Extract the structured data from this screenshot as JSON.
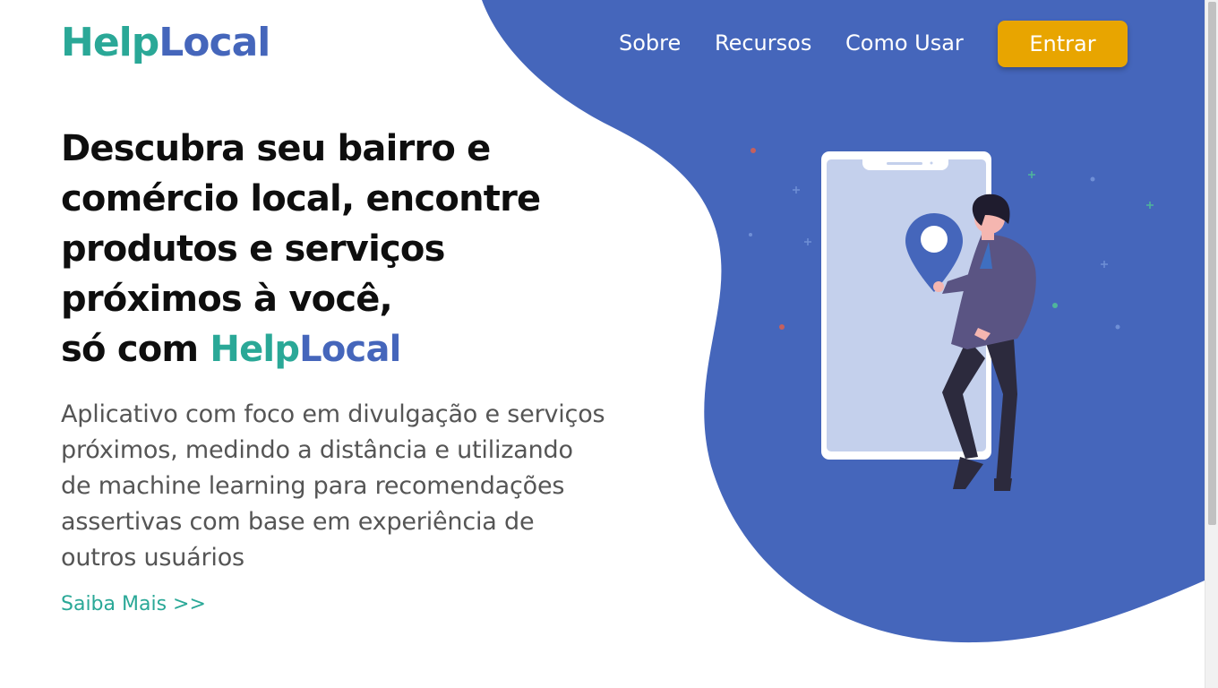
{
  "brand": {
    "help": "Help",
    "local": "Local"
  },
  "nav": {
    "items": [
      {
        "label": "Sobre"
      },
      {
        "label": "Recursos"
      },
      {
        "label": "Como Usar"
      }
    ],
    "cta_label": "Entrar"
  },
  "hero": {
    "headline_lines": [
      "Descubra seu bairro e",
      "comércio local, encontre",
      "produtos e serviços",
      "próximos à você,"
    ],
    "headline_prefix": "só com ",
    "description": "Aplicativo com foco em divulgação e serviços próximos, medindo a distância e utilizando de machine learning para recomendações assertivas com base em experiência de outros usuários",
    "link_label": "Saiba Mais >>"
  },
  "colors": {
    "blob": "#4566bb",
    "brand_green": "#2aa897",
    "brand_blue": "#4566bb",
    "cta": "#e8a500",
    "text_muted": "#555555"
  },
  "icons": [
    "location-pin-icon",
    "phone-illustration",
    "person-illustration"
  ]
}
